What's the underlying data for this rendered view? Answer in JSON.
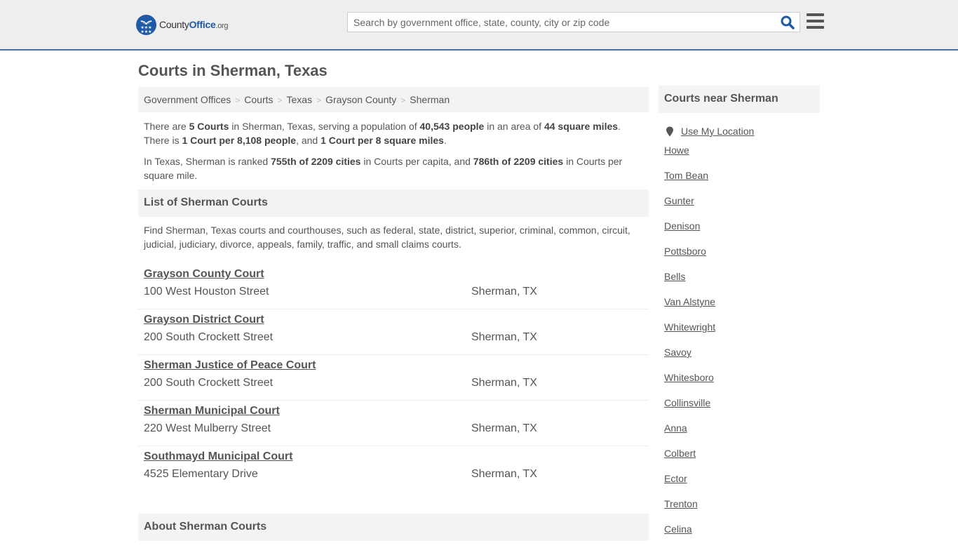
{
  "header": {
    "logo": {
      "name_part1": "County",
      "name_part2": "Office",
      "tld": ".org"
    },
    "search": {
      "placeholder": "Search by government office, state, county, city or zip code",
      "value": ""
    },
    "search_icon": "search-icon",
    "menu_icon": "hamburger-menu-icon"
  },
  "page": {
    "title": "Courts in Sherman, Texas"
  },
  "breadcrumb": [
    {
      "label": "Government Offices"
    },
    {
      "label": "Courts"
    },
    {
      "label": "Texas"
    },
    {
      "label": "Grayson County"
    },
    {
      "label": "Sherman"
    }
  ],
  "intro": {
    "p1": {
      "t1": "There are ",
      "b1": "5 Courts",
      "t2": " in Sherman, Texas, serving a population of ",
      "b2": "40,543 people",
      "t3": " in an area of ",
      "b3": "44 square miles",
      "t4": ". There is ",
      "b4": "1 Court per 8,108 people",
      "t5": ", and ",
      "b5": "1 Court per 8 square miles",
      "t6": "."
    },
    "p2": {
      "t1": "In Texas, Sherman is ranked ",
      "b1": "755th of 2209 cities",
      "t2": " in Courts per capita, and ",
      "b2": "786th of 2209 cities",
      "t3": " in Courts per square mile."
    }
  },
  "list_section": {
    "heading": "List of Sherman Courts",
    "description": "Find Sherman, Texas courts and courthouses, such as federal, state, district, superior, criminal, common, circuit, judicial, judiciary, divorce, appeals, family, traffic, and small claims courts.",
    "courts": [
      {
        "name": "Grayson County Court",
        "address": "100 West Houston Street",
        "city": "Sherman, TX"
      },
      {
        "name": "Grayson District Court",
        "address": "200 South Crockett Street",
        "city": "Sherman, TX"
      },
      {
        "name": "Sherman Justice of Peace Court",
        "address": "200 South Crockett Street",
        "city": "Sherman, TX"
      },
      {
        "name": "Sherman Municipal Court",
        "address": "220 West Mulberry Street",
        "city": "Sherman, TX"
      },
      {
        "name": "Southmayd Municipal Court",
        "address": "4525 Elementary Drive",
        "city": "Sherman, TX"
      }
    ]
  },
  "about_section": {
    "heading": "About Sherman Courts"
  },
  "sidebar": {
    "heading": "Courts near Sherman",
    "use_location": "Use My Location",
    "nearby": [
      "Howe",
      "Tom Bean",
      "Gunter",
      "Denison",
      "Pottsboro",
      "Bells",
      "Van Alstyne",
      "Whitewright",
      "Savoy",
      "Whitesboro",
      "Collinsville",
      "Anna",
      "Colbert",
      "Ector",
      "Trenton",
      "Celina"
    ]
  },
  "colors": {
    "header_bg": "#eeeeee",
    "header_border": "#3479b7",
    "brand_blue": "#1f5aa6",
    "text": "#555555",
    "panel_bg": "#f3f3f3"
  }
}
